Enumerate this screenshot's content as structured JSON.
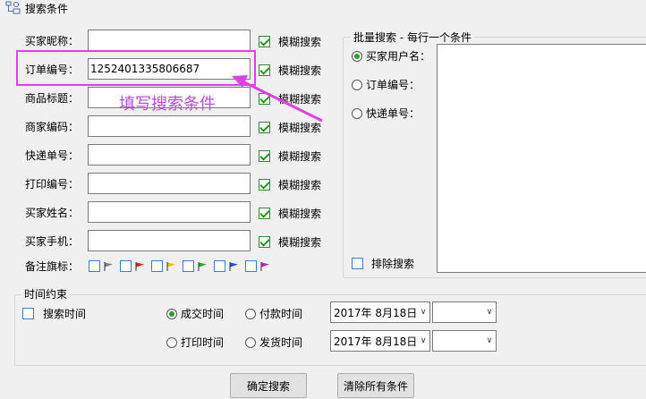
{
  "window": {
    "title": "搜索条件",
    "icon": "search-conditions-icon"
  },
  "fields": [
    {
      "label": "买家昵称：",
      "value": "",
      "fuzzy_label": "模糊搜索",
      "fuzzy_checked": true
    },
    {
      "label": "订单编号：",
      "value": "1252401335806687",
      "fuzzy_label": "模糊搜索",
      "fuzzy_checked": true
    },
    {
      "label": "商品标题：",
      "value": "",
      "fuzzy_label": "模糊搜索",
      "fuzzy_checked": true
    },
    {
      "label": "商家编码：",
      "value": "",
      "fuzzy_label": "模糊搜索",
      "fuzzy_checked": true
    },
    {
      "label": "快递单号：",
      "value": "",
      "fuzzy_label": "模糊搜索",
      "fuzzy_checked": true
    },
    {
      "label": "打印编号：",
      "value": "",
      "fuzzy_label": "模糊搜索",
      "fuzzy_checked": true
    },
    {
      "label": "买家姓名：",
      "value": "",
      "fuzzy_label": "模糊搜索",
      "fuzzy_checked": true
    },
    {
      "label": "买家手机：",
      "value": "",
      "fuzzy_label": "模糊搜索",
      "fuzzy_checked": true
    }
  ],
  "remark": {
    "label": "备注旗标：",
    "flags": [
      {
        "icon": "gray-flag-icon",
        "color": "#808080"
      },
      {
        "icon": "red-flag-icon",
        "color": "#e02020"
      },
      {
        "icon": "yellow-flag-icon",
        "color": "#e6c800"
      },
      {
        "icon": "green-flag-icon",
        "color": "#20b020"
      },
      {
        "icon": "blue-flag-icon",
        "color": "#2050e0"
      },
      {
        "icon": "purple-flag-icon",
        "color": "#c020c0"
      }
    ]
  },
  "batch": {
    "title": "批量搜索 - 每行一个条件",
    "options": [
      {
        "label": "买家用户名：",
        "selected": true
      },
      {
        "label": "订单编号：",
        "selected": false
      },
      {
        "label": "快递单号：",
        "selected": false
      }
    ],
    "exclude_label": "排除搜索",
    "textarea_value": ""
  },
  "time": {
    "title": "时间约束",
    "search_time_label": "搜索时间",
    "options": [
      {
        "label": "成交时间",
        "selected": true
      },
      {
        "label": "付款时间",
        "selected": false
      },
      {
        "label": "打印时间",
        "selected": false
      },
      {
        "label": "发货时间",
        "selected": false
      }
    ],
    "date_from": "2017年  8月18日",
    "date_to": "2017年  8月18日",
    "time_from": "",
    "time_to": ""
  },
  "buttons": {
    "confirm": "确定搜索",
    "clear": "清除所有条件"
  },
  "annotation": {
    "text": "填写搜索条件",
    "color": "#e040e8"
  }
}
